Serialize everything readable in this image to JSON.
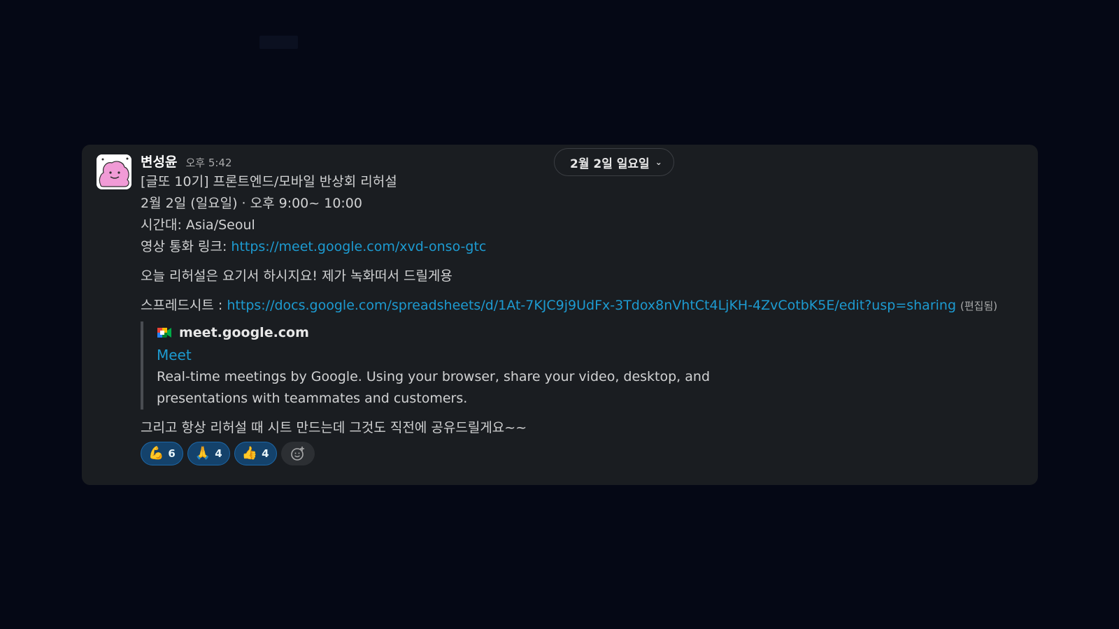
{
  "message": {
    "author": "변성윤",
    "time": "오후 5:42",
    "date_divider": "2월 2일 일요일",
    "lines": [
      "[글또 10기] 프론트엔드/모바일 반상회 리허설",
      "2월 2일 (일요일) · 오후 9:00~ 10:00",
      "시간대: Asia/Seoul"
    ],
    "meet_link_label": "영상 통화 링크: ",
    "meet_link": "https://meet.google.com/xvd-onso-gtc",
    "rehearsal_note": "오늘 리허설은 요기서 하시지요! 제가 녹화떠서 드릴게용",
    "sheet_label": "스프레드시트 : ",
    "sheet_link": "https://docs.google.com/spreadsheets/d/1At-7KJC9j9UdFx-3Tdox8nVhtCt4LjKH-4ZvCotbK5E/edit?usp=sharing",
    "edited": "(편집됨)",
    "closing": "그리고 항상 리허설 때 시트 만드는데 그것도 직전에 공유드릴게요~~"
  },
  "preview": {
    "site": "meet.google.com",
    "title": "Meet",
    "description_1": "Real-time meetings by Google. Using your browser, share your video, desktop, and",
    "description_2": "presentations with teammates and customers."
  },
  "reactions": [
    {
      "emoji": "💪",
      "count": "6"
    },
    {
      "emoji": "🙏",
      "count": "4"
    },
    {
      "emoji": "👍",
      "count": "4"
    }
  ],
  "colors": {
    "background": "#050815",
    "card": "#1a1d21",
    "link": "#1d9bd1",
    "reaction_bg": "#14426b"
  }
}
